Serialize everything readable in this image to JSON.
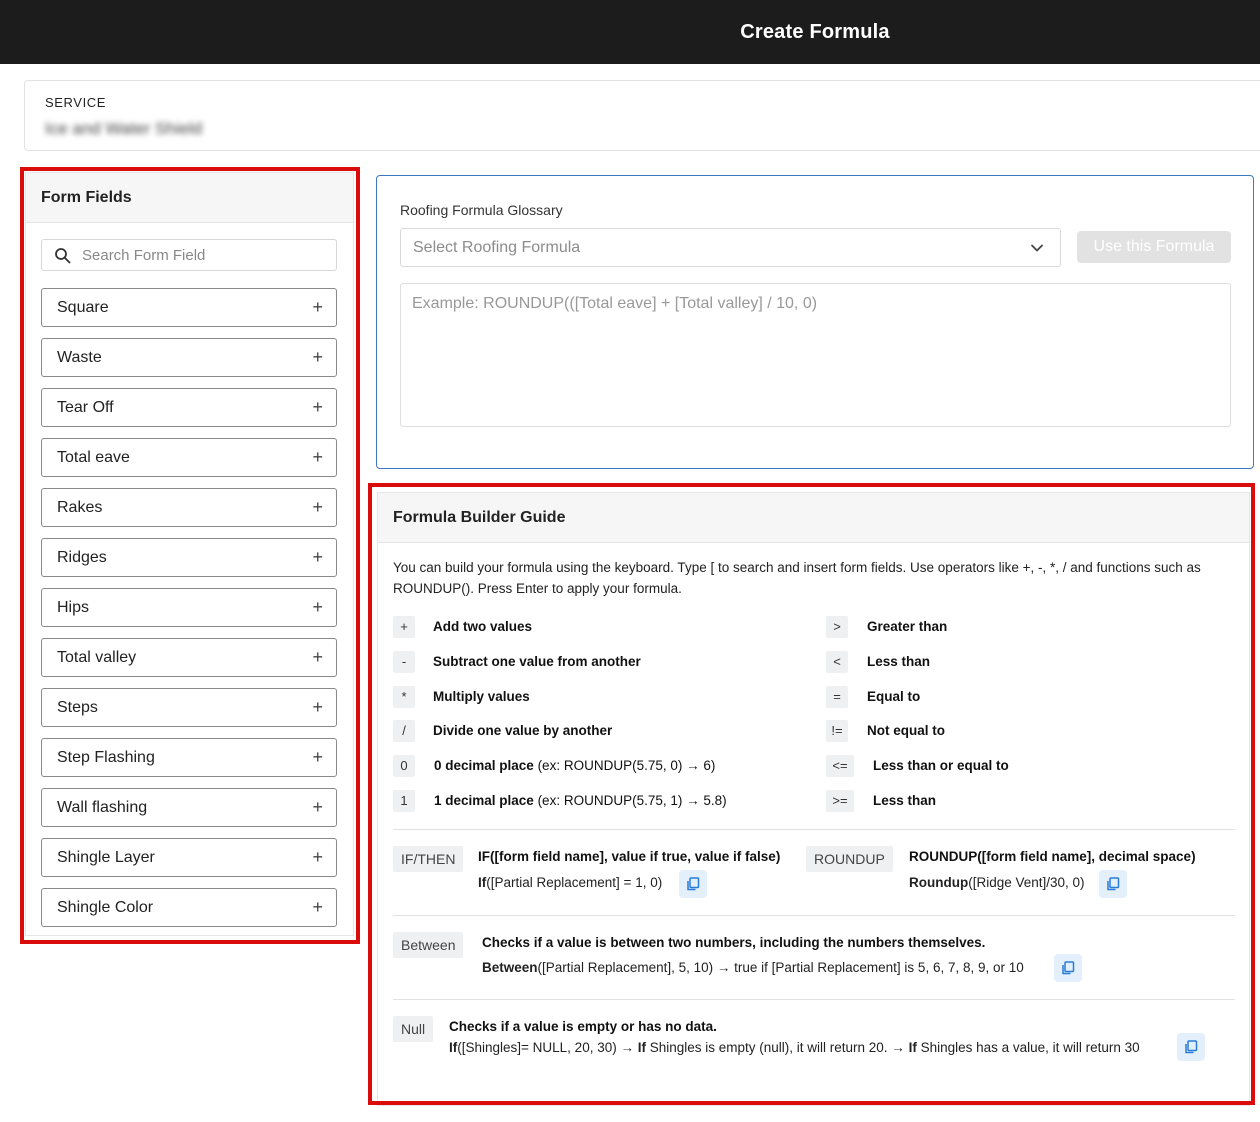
{
  "header": {
    "title": "Create Formula"
  },
  "service": {
    "label": "SERVICE",
    "value": "Ice and Water Shield"
  },
  "form_fields": {
    "title": "Form Fields",
    "search_placeholder": "Search Form Field",
    "items": [
      {
        "label": "Square"
      },
      {
        "label": "Waste"
      },
      {
        "label": "Tear Off"
      },
      {
        "label": "Total eave"
      },
      {
        "label": "Rakes"
      },
      {
        "label": "Ridges"
      },
      {
        "label": "Hips"
      },
      {
        "label": "Total valley"
      },
      {
        "label": "Steps"
      },
      {
        "label": "Step Flashing"
      },
      {
        "label": "Wall flashing"
      },
      {
        "label": "Shingle Layer"
      },
      {
        "label": "Shingle Color"
      }
    ],
    "add_symbol": "+"
  },
  "glossary": {
    "label": "Roofing Formula Glossary",
    "select_placeholder": "Select Roofing Formula",
    "use_button": "Use this Formula",
    "formula_placeholder": "Example: ROUNDUP(([Total eave] + [Total valley] / 10, 0)"
  },
  "guide": {
    "title": "Formula Builder Guide",
    "intro": "You can build your formula using the keyboard. Type [ to search and insert form fields. Use operators like +, -, *, / and functions such as ROUNDUP(). Press Enter to apply your formula.",
    "left_ops": [
      {
        "key": "+",
        "desc": "Add two values",
        "extra": ""
      },
      {
        "key": "-",
        "desc": "Subtract one value from another",
        "extra": ""
      },
      {
        "key": "*",
        "desc": "Multiply values",
        "extra": ""
      },
      {
        "key": "/",
        "desc": "Divide one value by another",
        "extra": ""
      },
      {
        "key": "0",
        "desc": "0 decimal place",
        "extra": " (ex: ROUNDUP(5.75, 0) → 6)"
      },
      {
        "key": "1",
        "desc": "1 decimal place",
        "extra": " (ex: ROUNDUP(5.75, 1) → 5.8)"
      }
    ],
    "right_ops": [
      {
        "key": ">",
        "desc": "Greater than"
      },
      {
        "key": "<",
        "desc": "Less than"
      },
      {
        "key": "=",
        "desc": "Equal to"
      },
      {
        "key": "!=",
        "desc": "Not equal to"
      },
      {
        "key": "<=",
        "desc": "Less than or equal to"
      },
      {
        "key": ">=",
        "desc": "Less than"
      }
    ],
    "ifthen": {
      "tag": "IF/THEN",
      "title": "IF([form field name], value if true, value if false)",
      "example_fn": "If",
      "example_rest": "([Partial Replacement] = 1, 0)"
    },
    "roundup": {
      "tag": "ROUNDUP",
      "title": "ROUNDUP([form field name], decimal space)",
      "example_fn": "Roundup",
      "example_rest": "([Ridge Vent]/30, 0)"
    },
    "between": {
      "tag": "Between",
      "title": "Checks if a value is between two numbers, including the numbers themselves.",
      "example_fn": "Between",
      "example_rest": "([Partial Replacement], 5, 10) → true if [Partial Replacement] is 5, 6, 7, 8, 9, or 10"
    },
    "null": {
      "tag": "Null",
      "title": "Checks if a value is empty or has no data.",
      "example_fn1": "If",
      "example_part1": "([Shingles]= NULL, 20, 30) → ",
      "example_fn2": "If",
      "example_part2": " Shingles is empty (null), it will return 20. → ",
      "example_fn3": "If",
      "example_part3": " Shingles has a value, it will return 30"
    }
  },
  "colors": {
    "highlight": "#d90b0b",
    "accent": "#3d78c2",
    "header_bg": "#1c1c1c"
  }
}
